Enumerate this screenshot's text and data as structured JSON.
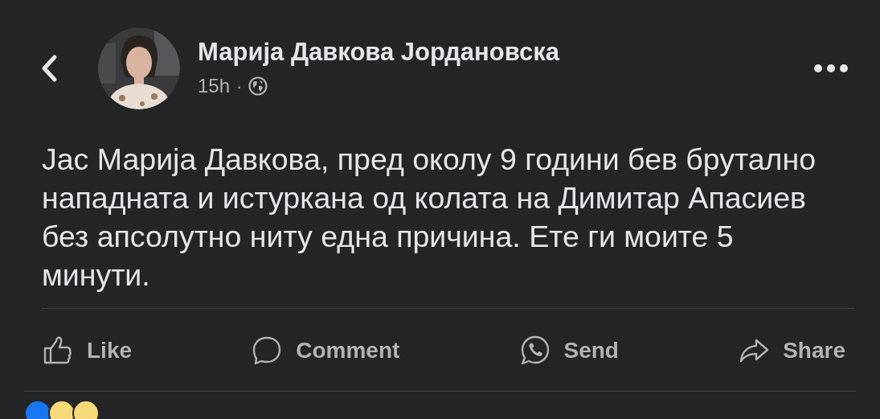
{
  "post": {
    "author": "Марија Давкова Јордановска",
    "time": "15h",
    "separator": "·",
    "text": "Јас Марија Давкова, пред околу 9 години бев брутално нападната и истуркана од колата на Димитар Апасиев без апсолутно ниту една причина. Ете ги моите 5 минути."
  },
  "actions": [
    {
      "kind": "like",
      "label": "Like"
    },
    {
      "kind": "comment",
      "label": "Comment"
    },
    {
      "kind": "send",
      "label": "Send"
    },
    {
      "kind": "share",
      "label": "Share"
    }
  ],
  "reactions": [
    {
      "color": "#1877f2"
    },
    {
      "color": "#f7d97a"
    },
    {
      "color": "#f7d97a"
    }
  ]
}
